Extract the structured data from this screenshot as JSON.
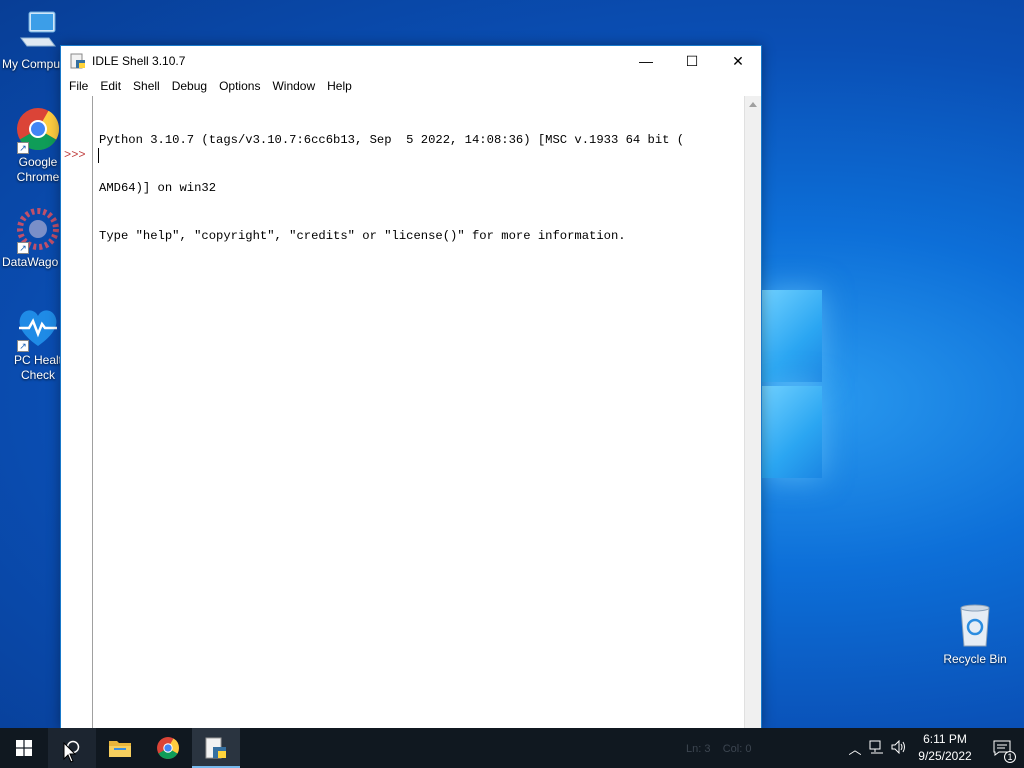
{
  "desktop": {
    "icons": [
      {
        "label": "My Compu"
      },
      {
        "label": "Google Chrome"
      },
      {
        "label": "DataWago"
      },
      {
        "label": "PC Healt Check"
      }
    ],
    "recycle_bin": "Recycle Bin"
  },
  "window": {
    "title": "IDLE Shell 3.10.7",
    "controls": {
      "minimize": "—",
      "maximize": "☐",
      "close": "✕"
    },
    "menu": [
      "File",
      "Edit",
      "Shell",
      "Debug",
      "Options",
      "Window",
      "Help"
    ],
    "shell": {
      "lines": [
        "Python 3.10.7 (tags/v3.10.7:6cc6b13, Sep  5 2022, 14:08:36) [MSC v.1933 64 bit (",
        "AMD64)] on win32",
        "Type \"help\", \"copyright\", \"credits\" or \"license()\" for more information."
      ],
      "prompt": ">>>"
    },
    "status": {
      "line": "Ln: 3",
      "col": "Col: 0"
    }
  },
  "taskbar": {
    "apps": [
      "start-icon",
      "search-icon",
      "file-explorer-icon",
      "chrome-icon",
      "idle-icon"
    ],
    "clock": {
      "time": "6:11 PM",
      "date": "9/25/2022"
    },
    "notification_count": "1"
  },
  "colors": {
    "accent": "#1979ca",
    "prompt": "#c04040",
    "taskbar": "#101820"
  }
}
